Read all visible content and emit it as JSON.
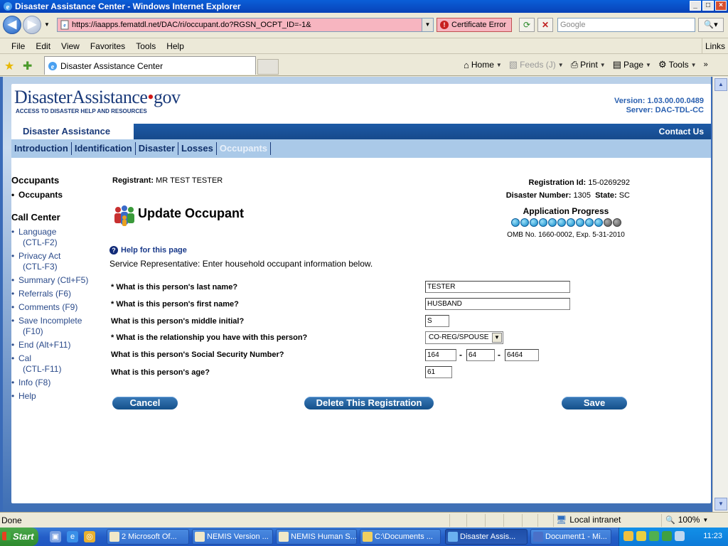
{
  "window": {
    "title": "Disaster Assistance Center - Windows Internet Explorer"
  },
  "browser": {
    "url": "https://iaapps.fematdl.net/DAC/ri/occupant.do?RGSN_OCPT_ID=-1&",
    "cert_error": "Certificate Error",
    "search_placeholder": "Google",
    "menu": [
      "File",
      "Edit",
      "View",
      "Favorites",
      "Tools",
      "Help"
    ],
    "links_label": "Links",
    "tab_title": "Disaster Assistance Center",
    "commands": {
      "home": "Home",
      "feeds": "Feeds (J)",
      "print": "Print",
      "page": "Page",
      "tools": "Tools"
    }
  },
  "site": {
    "logo_main": "DisasterAssistance",
    "logo_dot": "•",
    "logo_suffix": "gov",
    "tagline": "ACCESS TO DISASTER HELP AND RESOURCES",
    "version": "Version: 1.03.00.00.0489",
    "server": "Server: DAC-TDL-CC",
    "app_name": "Disaster Assistance",
    "contact": "Contact Us",
    "nav": [
      "Introduction",
      "Identification",
      "Disaster",
      "Losses",
      "Occupants"
    ]
  },
  "sidebar": {
    "occupants_heading": "Occupants",
    "occupants_item": "Occupants",
    "call_center_heading": "Call Center",
    "items": [
      {
        "label": "Language",
        "sub": "(CTL-F2)"
      },
      {
        "label": "Privacy Act",
        "sub": "(CTL-F3)"
      },
      {
        "label": "Summary (Ctl+F5)",
        "sub": ""
      },
      {
        "label": "Referrals (F6)",
        "sub": ""
      },
      {
        "label": "Comments (F9)",
        "sub": ""
      },
      {
        "label": "Save Incomplete",
        "sub": "(F10)"
      },
      {
        "label": "End (Alt+F11)",
        "sub": ""
      },
      {
        "label": "Cal",
        "sub": "(CTL-F11)"
      },
      {
        "label": "Info (F8)",
        "sub": ""
      },
      {
        "label": "Help",
        "sub": ""
      }
    ]
  },
  "main": {
    "registrant_label": "Registrant:",
    "registrant_value": "MR TEST TESTER",
    "registration_id_label": "Registration Id:",
    "registration_id_value": "15-0269292",
    "disaster_number_label": "Disaster Number:",
    "disaster_number_value": "1305",
    "state_label": "State:",
    "state_value": "SC",
    "page_title": "Update Occupant",
    "progress_label": "Application Progress",
    "progress_done": 10,
    "progress_total": 12,
    "omb": "OMB No. 1660-0002, Exp. 5-31-2010",
    "help_link": "Help for this page",
    "instructions": "Service Representative: Enter household occupant information below."
  },
  "form": {
    "last_name_label": "* What is this person's last name?",
    "last_name_value": "TESTER",
    "first_name_label": "* What is this person's first name?",
    "first_name_value": "HUSBAND",
    "middle_initial_label": "What is this person's middle initial?",
    "middle_initial_value": "S",
    "relationship_label": "* What is the relationship you have with this person?",
    "relationship_value": "CO-REG/SPOUSE",
    "ssn_label": "What is this person's Social Security Number?",
    "ssn_part1": "164",
    "ssn_part2": "64",
    "ssn_part3": "6464",
    "ssn_separator": "-",
    "age_label": "What is this person's age?",
    "age_value": "61",
    "cancel_label": "Cancel",
    "delete_label": "Delete This Registration",
    "save_label": "Save"
  },
  "statusbar": {
    "status": "Done",
    "zone": "Local intranet",
    "zoom": "100%"
  },
  "taskbar": {
    "start": "Start",
    "tasks": [
      "2 Microsoft Of...",
      "NEMIS Version ...",
      "NEMIS Human S...",
      "C:\\Documents ...",
      "Disaster Assis...",
      "Document1 - Mi..."
    ],
    "clock": "11:23"
  }
}
